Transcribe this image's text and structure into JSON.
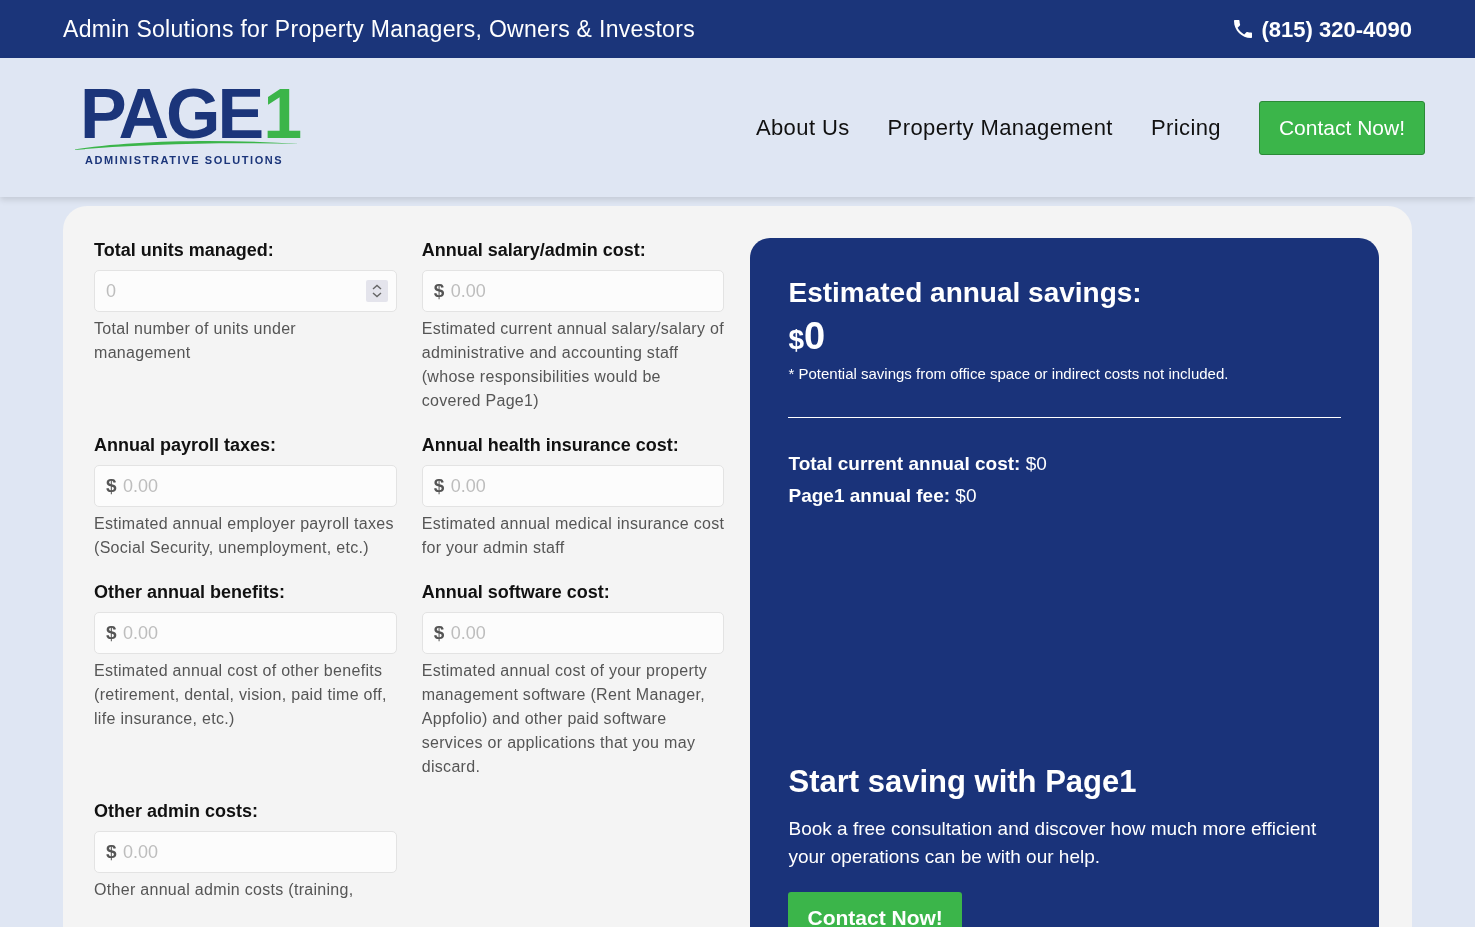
{
  "top_bar": {
    "tagline": "Admin Solutions for Property Managers, Owners & Investors",
    "phone": "(815) 320-4090"
  },
  "header": {
    "logo": {
      "wordmark": "PAGE",
      "wordmark_digit": "1",
      "tagline": "ADMINISTRATIVE SOLUTIONS"
    },
    "nav": [
      {
        "label": "About Us"
      },
      {
        "label": "Property Management"
      },
      {
        "label": "Pricing"
      }
    ],
    "cta": "Contact Now!"
  },
  "calculator": {
    "fields": [
      {
        "kind": "number",
        "label": "Total units managed:",
        "placeholder": "0",
        "help": "Total number of units under management"
      },
      {
        "kind": "currency",
        "label": "Annual salary/admin cost:",
        "prefix": "$",
        "placeholder": "0.00",
        "help": "Estimated current annual salary/salary of administrative and accounting staff (whose responsibilities would be covered Page1)"
      },
      {
        "kind": "currency",
        "label": "Annual payroll taxes:",
        "prefix": "$",
        "placeholder": "0.00",
        "help": "Estimated annual employer payroll taxes (Social Security, unemployment, etc.)"
      },
      {
        "kind": "currency",
        "label": "Annual health insurance cost:",
        "prefix": "$",
        "placeholder": "0.00",
        "help": "Estimated annual medical insurance cost for your admin staff"
      },
      {
        "kind": "currency",
        "label": "Other annual benefits:",
        "prefix": "$",
        "placeholder": "0.00",
        "help": "Estimated annual cost of other benefits (retirement, dental, vision, paid time off, life insurance, etc.)"
      },
      {
        "kind": "currency",
        "label": "Annual software cost:",
        "prefix": "$",
        "placeholder": "0.00",
        "help": "Estimated annual cost of your property management software (Rent Manager, Appfolio) and other paid software services or applications that you may discard."
      },
      {
        "kind": "currency",
        "label": "Other admin costs:",
        "prefix": "$",
        "placeholder": "0.00",
        "help": "Other annual admin costs (training,"
      }
    ]
  },
  "results": {
    "title": "Estimated annual savings:",
    "savings_currency": "$",
    "savings_amount": "0",
    "note": "* Potential savings from office space or indirect costs not included.",
    "lines": [
      "**Total current annual cost:** $0",
      "**Page1 annual fee:** $0"
    ],
    "cta_title": "Start saving with Page1",
    "cta_text": "Book a free consultation and discover how much more efficient your operations can be with our help.",
    "cta_button": "Contact Now!"
  }
}
